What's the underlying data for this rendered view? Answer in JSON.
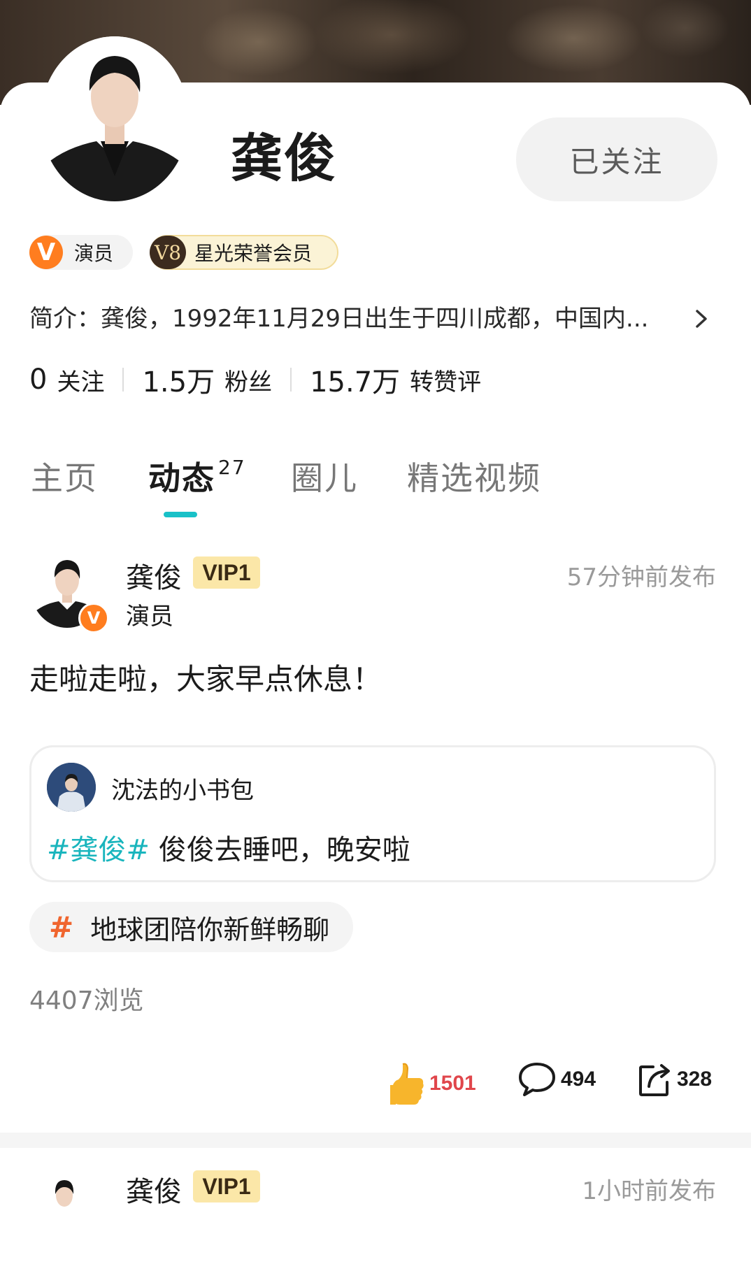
{
  "profile": {
    "name": "龚俊",
    "follow_button": "已关注",
    "badges": {
      "role": "演员",
      "role_icon": "V",
      "vip_level": "V8",
      "vip_label": "星光荣誉会员"
    },
    "intro": "简介：龚俊，1992年11月29日出生于四川成都，中国内...",
    "stats": [
      {
        "value": "0",
        "label": "关注"
      },
      {
        "value": "1.5万",
        "label": "粉丝"
      },
      {
        "value": "15.7万",
        "label": "转赞评"
      }
    ]
  },
  "tabs": [
    {
      "label": "主页"
    },
    {
      "label": "动态",
      "count": "27",
      "active": true
    },
    {
      "label": "圈儿"
    },
    {
      "label": "精选视频"
    }
  ],
  "post": {
    "author": "龚俊",
    "vip": "VIP1",
    "role": "演员",
    "time": "57分钟前发布",
    "text": "走啦走啦，大家早点休息！",
    "repost": {
      "author": "沈法的小书包",
      "tag": "#龚俊#",
      "text": "俊俊去睡吧，晚安啦"
    },
    "topic": {
      "hash": "#",
      "label": "地球团陪你新鲜畅聊"
    },
    "views": "4407浏览",
    "likes": "1501",
    "comments": "494",
    "shares": "328"
  },
  "post2": {
    "author": "龚俊",
    "vip": "VIP1",
    "time": "1小时前发布"
  },
  "colors": {
    "accent": "#19c1c8",
    "topic_hash": "#f0652e",
    "like": "#e0464b",
    "vip_bg": "#fbe7a8",
    "role_badge": "#ff7d1f"
  }
}
